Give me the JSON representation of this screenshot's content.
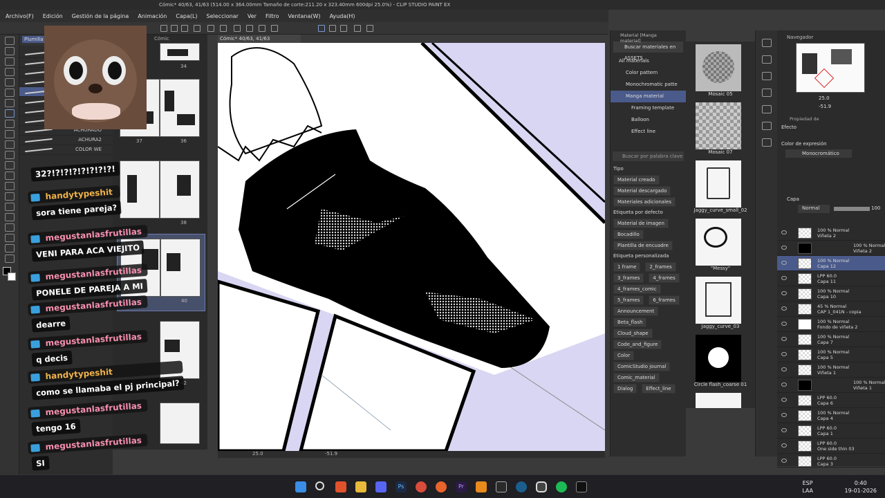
{
  "title_bar": {
    "text": "Cómic* 40/63, 41/63 (514.00 x 364.00mm Tamaño de corte:211.20 x 323.40mm 600dpi 25.0%) - CLIP STUDIO PAINT EX"
  },
  "menu": [
    "Archivo(F)",
    "Edición",
    "Gestión de la página",
    "Animación",
    "Capa(L)",
    "Seleccionar",
    "Ver",
    "Filtro",
    "Ventana(W)",
    "Ayuda(H)"
  ],
  "brush_panel": {
    "tab": "Plumilla",
    "brushes": [
      "",
      "",
      "",
      "",
      "",
      "",
      "",
      "",
      "ACHURADO",
      "ACHURA2",
      "COLOR WE"
    ]
  },
  "pages": [
    {
      "left": "",
      "right": "34"
    },
    {
      "left": "37",
      "right": "36"
    },
    {
      "left": "",
      "right": "38"
    },
    {
      "left": "41",
      "right": "40",
      "selected": true
    },
    {
      "left": "",
      "right": "42"
    },
    {
      "left": "",
      "right": ""
    }
  ],
  "pages_tab": "Cómic",
  "canvas": {
    "tab": "Cómic* 40/63, 41/63",
    "zoom": "25.0",
    "angle": "-51.9"
  },
  "materials": {
    "panel_title": "Material [Manga material]",
    "search_assets": "Buscar materiales en ASSETS",
    "tree": [
      "All materials",
      "Color pattern",
      "Monochromatic patte",
      "Manga material",
      "Framing template",
      "Balloon",
      "Effect line"
    ],
    "tree_selected": "Manga material",
    "keyword_placeholder": "Buscar por palabra clave",
    "tipo_label": "Tipo",
    "tipo_tags": [
      "Material creado",
      "Material descargado",
      "Materiales adicionales"
    ],
    "default_label": "Etiqueta por defecto",
    "default_tags": [
      "Material de imagen",
      "Bocadillo",
      "Plantilla de encuadre"
    ],
    "custom_label": "Etiqueta personalizada",
    "custom_tags": [
      "1 frame",
      "2_frames",
      "3_frames",
      "4_frames",
      "4_frames_comic",
      "5_frames",
      "6_frames",
      "Announcement",
      "Beta_flash",
      "Cloud_shape",
      "Code_and_figure",
      "Color",
      "ComicStudio journal",
      "Comic_material",
      "Dialog",
      "Effect_line"
    ],
    "items": [
      "Mosaic 05",
      "Mosaic 07",
      "Jaggy_curve_small_02",
      "\"Messy\"",
      "Jaggy_curve_03",
      "Circle flash_coarse 01",
      ""
    ]
  },
  "navigator": {
    "title": "Navegador",
    "zoom": "25.0",
    "angle": "-51.9"
  },
  "properties": {
    "title": "Propiedad de",
    "effect_label": "Efecto",
    "color_label": "Color de expresión",
    "color_value": "Monocromático"
  },
  "layers": {
    "title": "Capa",
    "blend": "Normal",
    "opacity": "100",
    "items": [
      {
        "l1": "100 % Normal",
        "l2": "Viñeta 2"
      },
      {
        "l1": "100 % Normal",
        "l2": "Viñeta 2"
      },
      {
        "l1": "100 % Normal",
        "l2": "Capa 12",
        "selected": true
      },
      {
        "l1": "LPP 60.0",
        "l2": "Capa 11"
      },
      {
        "l1": "100 % Normal",
        "l2": "Capa 10"
      },
      {
        "l1": "45 % Normal",
        "l2": "CAP 1_041N - copia"
      },
      {
        "l1": "100 % Normal",
        "l2": "Fondo de viñeta 2"
      },
      {
        "l1": "100 % Normal",
        "l2": "Capa 7"
      },
      {
        "l1": "100 % Normal",
        "l2": "Capa 5"
      },
      {
        "l1": "100 % Normal",
        "l2": "Viñeta 1"
      },
      {
        "l1": "100 % Normal",
        "l2": "Viñeta 1"
      },
      {
        "l1": "LPP 60.0",
        "l2": "Capa 6"
      },
      {
        "l1": "100 % Normal",
        "l2": "Capa 4"
      },
      {
        "l1": "LPP 60.0",
        "l2": "Capa 1"
      },
      {
        "l1": "LPP 60.0",
        "l2": "One side thin 03"
      },
      {
        "l1": "LPP 60.0",
        "l2": "Capa 3"
      }
    ]
  },
  "chat": [
    {
      "user": "",
      "text": "32?!?!?!?!?!?!?!?!",
      "color": "#ffffff"
    },
    {
      "user": "handytypeshit",
      "text": "sora tiene pareja?",
      "color": "#f0b34a"
    },
    {
      "user": "megustanlasfrutillas",
      "text": "VENI PARA ACA VIEJITO",
      "color": "#f78fb0"
    },
    {
      "user": "megustanlasfrutillas",
      "text": "PONELE DE PAREJA A MI",
      "color": "#f78fb0"
    },
    {
      "user": "megustanlasfrutillas",
      "text": "dearre",
      "color": "#f78fb0"
    },
    {
      "user": "megustanlasfrutillas",
      "text": "q decis",
      "color": "#f78fb0"
    },
    {
      "user": "handytypeshit",
      "text": "como se llamaba el pj principal?",
      "color": "#f0b34a"
    },
    {
      "user": "megustanlasfrutillas",
      "text": "tengo 16",
      "color": "#f78fb0"
    },
    {
      "user": "megustanlasfrutillas",
      "text": "SI",
      "color": "#f78fb0"
    }
  ],
  "taskbar": {
    "apps": [
      "windows-icon",
      "search-icon",
      "brave-icon",
      "explorer-icon",
      "discord-icon",
      "photoshop-icon",
      "chrome-icon",
      "firefox-icon",
      "premiere-icon",
      "vlc-icon",
      "epic-icon",
      "steam-icon",
      "clipstudio-icon",
      "spotify-icon",
      "capcut-icon"
    ],
    "lang1": "ESP",
    "lang2": "LAA",
    "time": "0:40",
    "date": "19-01-2026"
  },
  "colors": {
    "accent": "#4a5a8a",
    "canvas_bg": "#d8d6f2",
    "chat_pink": "#f78fb0",
    "chat_orange": "#f0b34a"
  }
}
